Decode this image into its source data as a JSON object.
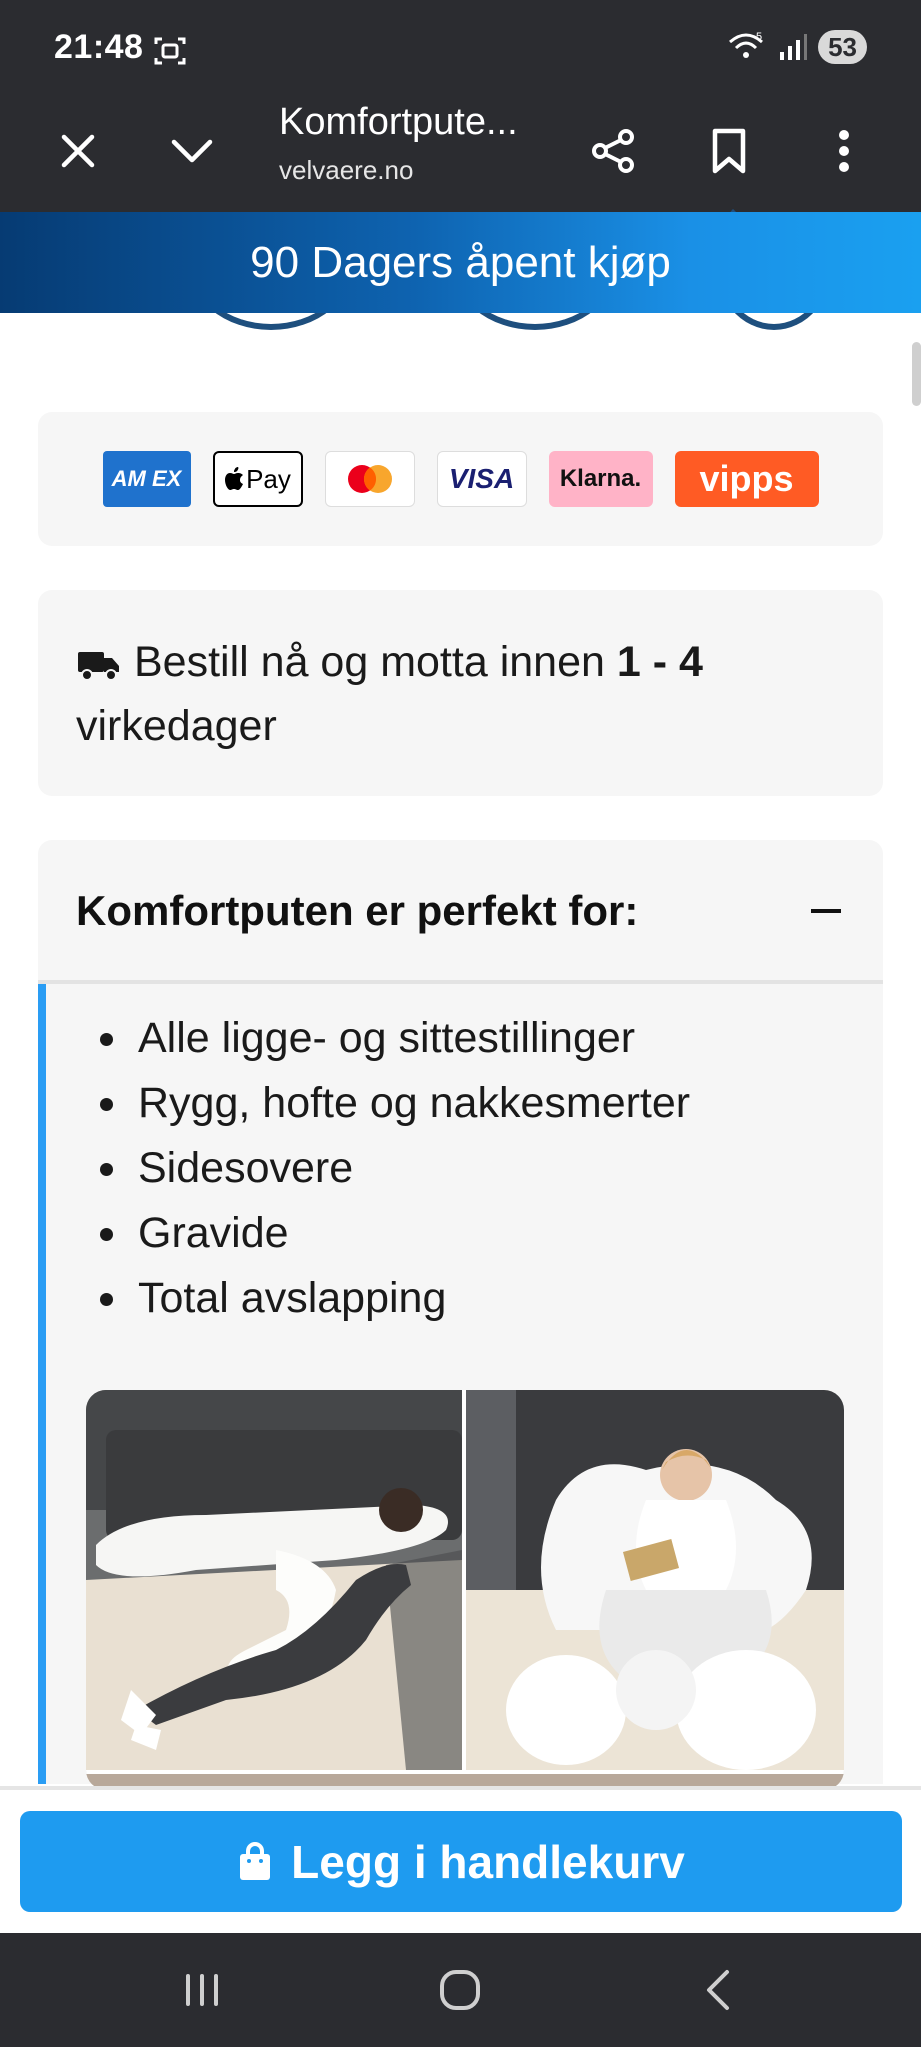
{
  "status_bar": {
    "time": "21:48",
    "battery": "53",
    "wifi_label": "5"
  },
  "browser": {
    "title": "Komfortpute...",
    "url": "velvaere.no"
  },
  "promo": {
    "text": "90 Dagers åpent kjøp"
  },
  "payments": {
    "amex": "AM EX",
    "applepay": "Pay",
    "visa": "VISA",
    "klarna": "Klarna.",
    "vipps": "vipps"
  },
  "delivery": {
    "prefix": "Bestill nå og motta innen ",
    "range": "1 - 4",
    "suffix": " virkedager"
  },
  "accordion": {
    "title": "Komfortputen er perfekt for:",
    "items": [
      "Alle ligge- og sittestillinger",
      "Rygg, hofte og nakkesmerter",
      "Sidesovere",
      "Gravide",
      "Total avslapping"
    ]
  },
  "cart": {
    "label": "Legg i handlekurv"
  },
  "colors": {
    "accent": "#1e9bf0",
    "bar": "#2b2c30",
    "card": "#f6f6f6"
  },
  "icons": [
    "close-icon",
    "chevron-down-icon",
    "share-icon",
    "bookmark-icon",
    "more-vert-icon",
    "truck-icon",
    "shopping-bag-icon",
    "recent-apps-icon",
    "home-icon",
    "back-icon"
  ]
}
